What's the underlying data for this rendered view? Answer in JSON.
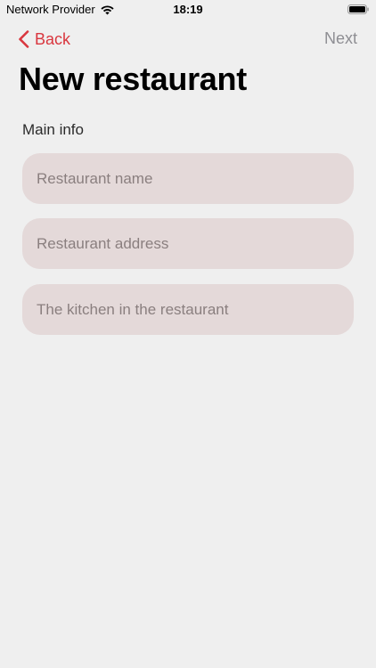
{
  "status_bar": {
    "carrier": "Network Provider",
    "time": "18:19",
    "icons": [
      "wifi-icon",
      "battery-icon"
    ]
  },
  "nav": {
    "back_label": "Back",
    "next_label": "Next",
    "accent_color": "#d9363e",
    "disabled_color": "#8e8e93"
  },
  "page": {
    "title": "New restaurant",
    "section_label": "Main info"
  },
  "form": {
    "fields": [
      {
        "placeholder": "Restaurant name",
        "value": ""
      },
      {
        "placeholder": "Restaurant address",
        "value": ""
      },
      {
        "placeholder": "The kitchen in the restaurant",
        "value": ""
      }
    ],
    "field_background": "#e4d9d9"
  }
}
